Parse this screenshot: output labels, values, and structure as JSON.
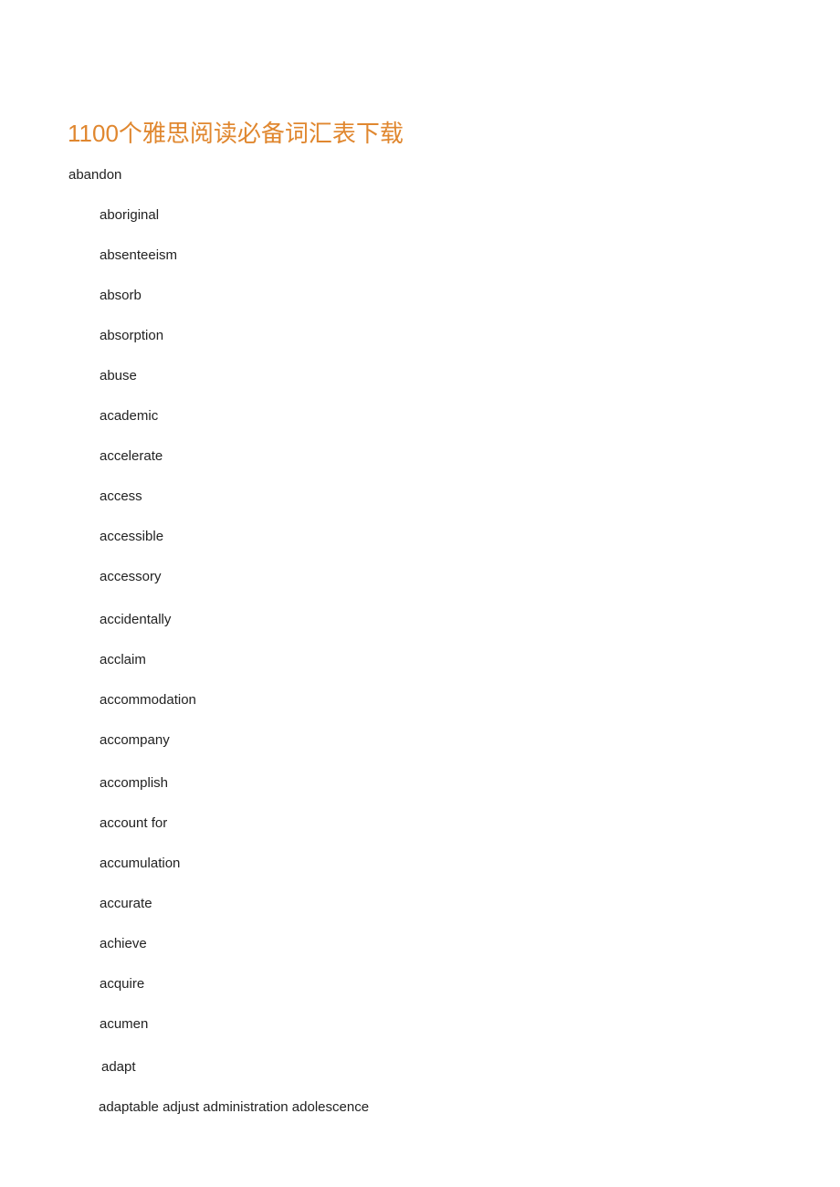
{
  "document": {
    "title": "1100个雅思阅读必备词汇表下载",
    "title_color": "#E0872F",
    "body_color": "#222222",
    "background_color": "#FFFFFF"
  },
  "word_list": {
    "items": [
      {
        "text": "abandon",
        "indent": 0
      },
      {
        "text": "aboriginal",
        "indent": 1
      },
      {
        "text": "absenteeism",
        "indent": 1
      },
      {
        "text": "absorb",
        "indent": 1
      },
      {
        "text": "absorption",
        "indent": 1
      },
      {
        "text": "abuse",
        "indent": 1
      },
      {
        "text": "academic",
        "indent": 1
      },
      {
        "text": "accelerate",
        "indent": 1
      },
      {
        "text": "access",
        "indent": 1
      },
      {
        "text": "accessible",
        "indent": 1
      },
      {
        "text": "accessory",
        "indent": 1
      },
      {
        "text": "accidentally",
        "indent": 1
      },
      {
        "text": "acclaim",
        "indent": 1
      },
      {
        "text": "accommodation",
        "indent": 1
      },
      {
        "text": "accompany",
        "indent": 1
      },
      {
        "text": "accomplish",
        "indent": 1
      },
      {
        "text": "account for",
        "indent": 1
      },
      {
        "text": "accumulation",
        "indent": 1
      },
      {
        "text": "accurate",
        "indent": 1
      },
      {
        "text": "achieve",
        "indent": 1
      },
      {
        "text": "acquire",
        "indent": 1
      },
      {
        "text": "acumen",
        "indent": 1
      },
      {
        "text": "adapt",
        "indent": 1
      },
      {
        "text": "adaptable adjust administration adolescence",
        "indent": 1
      }
    ]
  }
}
